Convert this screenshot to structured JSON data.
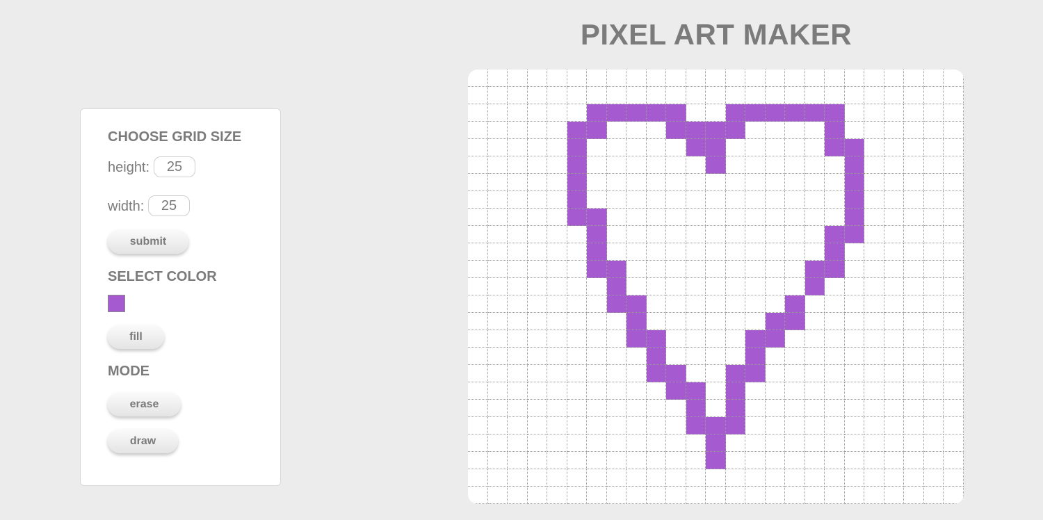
{
  "page": {
    "title": "PIXEL ART MAKER"
  },
  "controls": {
    "grid_size_title": "CHOOSE GRID SIZE",
    "height_label": "height:",
    "height_value": "25",
    "width_label": "width:",
    "width_value": "25",
    "submit_label": "submit",
    "color_title": "SELECT COLOR",
    "selected_color": "#a55acf",
    "fill_label": "fill",
    "mode_title": "MODE",
    "erase_label": "erase",
    "draw_label": "draw"
  },
  "canvas": {
    "rows": 25,
    "cols": 25,
    "background_color": "#ffffff",
    "grid_line_color": "#9a9a9a",
    "painted_color": "#a55acf",
    "painted_cells": [
      [
        2,
        6
      ],
      [
        2,
        7
      ],
      [
        2,
        8
      ],
      [
        2,
        9
      ],
      [
        2,
        10
      ],
      [
        2,
        13
      ],
      [
        2,
        14
      ],
      [
        2,
        15
      ],
      [
        2,
        16
      ],
      [
        2,
        17
      ],
      [
        2,
        18
      ],
      [
        3,
        5
      ],
      [
        3,
        6
      ],
      [
        3,
        10
      ],
      [
        3,
        11
      ],
      [
        3,
        12
      ],
      [
        3,
        13
      ],
      [
        3,
        18
      ],
      [
        4,
        5
      ],
      [
        4,
        11
      ],
      [
        4,
        12
      ],
      [
        4,
        18
      ],
      [
        4,
        19
      ],
      [
        5,
        5
      ],
      [
        5,
        12
      ],
      [
        5,
        19
      ],
      [
        6,
        5
      ],
      [
        6,
        19
      ],
      [
        7,
        5
      ],
      [
        7,
        19
      ],
      [
        8,
        5
      ],
      [
        8,
        6
      ],
      [
        8,
        19
      ],
      [
        9,
        6
      ],
      [
        9,
        18
      ],
      [
        9,
        19
      ],
      [
        10,
        6
      ],
      [
        10,
        18
      ],
      [
        11,
        6
      ],
      [
        11,
        7
      ],
      [
        11,
        17
      ],
      [
        11,
        18
      ],
      [
        12,
        7
      ],
      [
        12,
        17
      ],
      [
        13,
        7
      ],
      [
        13,
        8
      ],
      [
        13,
        16
      ],
      [
        14,
        8
      ],
      [
        14,
        15
      ],
      [
        14,
        16
      ],
      [
        15,
        8
      ],
      [
        15,
        9
      ],
      [
        15,
        14
      ],
      [
        15,
        15
      ],
      [
        16,
        9
      ],
      [
        16,
        14
      ],
      [
        17,
        9
      ],
      [
        17,
        10
      ],
      [
        17,
        13
      ],
      [
        17,
        14
      ],
      [
        18,
        10
      ],
      [
        18,
        11
      ],
      [
        18,
        13
      ],
      [
        19,
        11
      ],
      [
        19,
        13
      ],
      [
        20,
        11
      ],
      [
        20,
        12
      ],
      [
        20,
        13
      ],
      [
        21,
        12
      ],
      [
        22,
        12
      ]
    ]
  }
}
